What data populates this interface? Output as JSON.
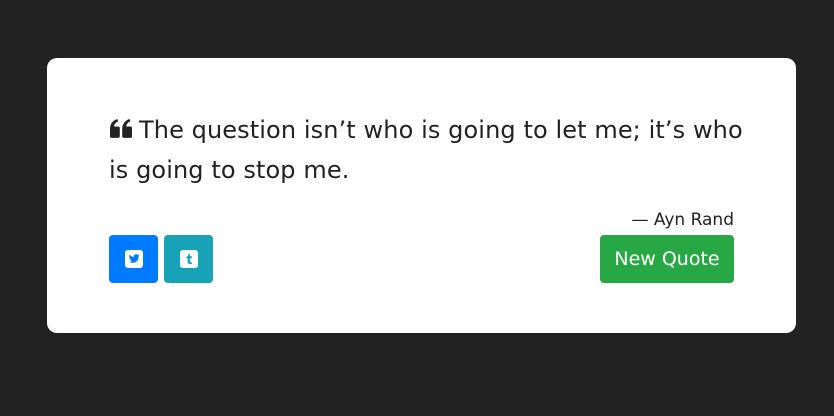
{
  "quote": {
    "text": "The question isn’t who is going to let me; it’s who is going to stop me.",
    "author": "— Ayn Rand",
    "icon": "quote-left-icon"
  },
  "actions": {
    "tweet_icon": "twitter-icon",
    "tumblr_icon": "tumblr-icon",
    "new_quote_label": "New Quote"
  },
  "colors": {
    "background": "#222222",
    "card": "#ffffff",
    "text": "#222222",
    "twitter": "#007bff",
    "tumblr": "#17a2b8",
    "new_quote": "#28a745"
  }
}
